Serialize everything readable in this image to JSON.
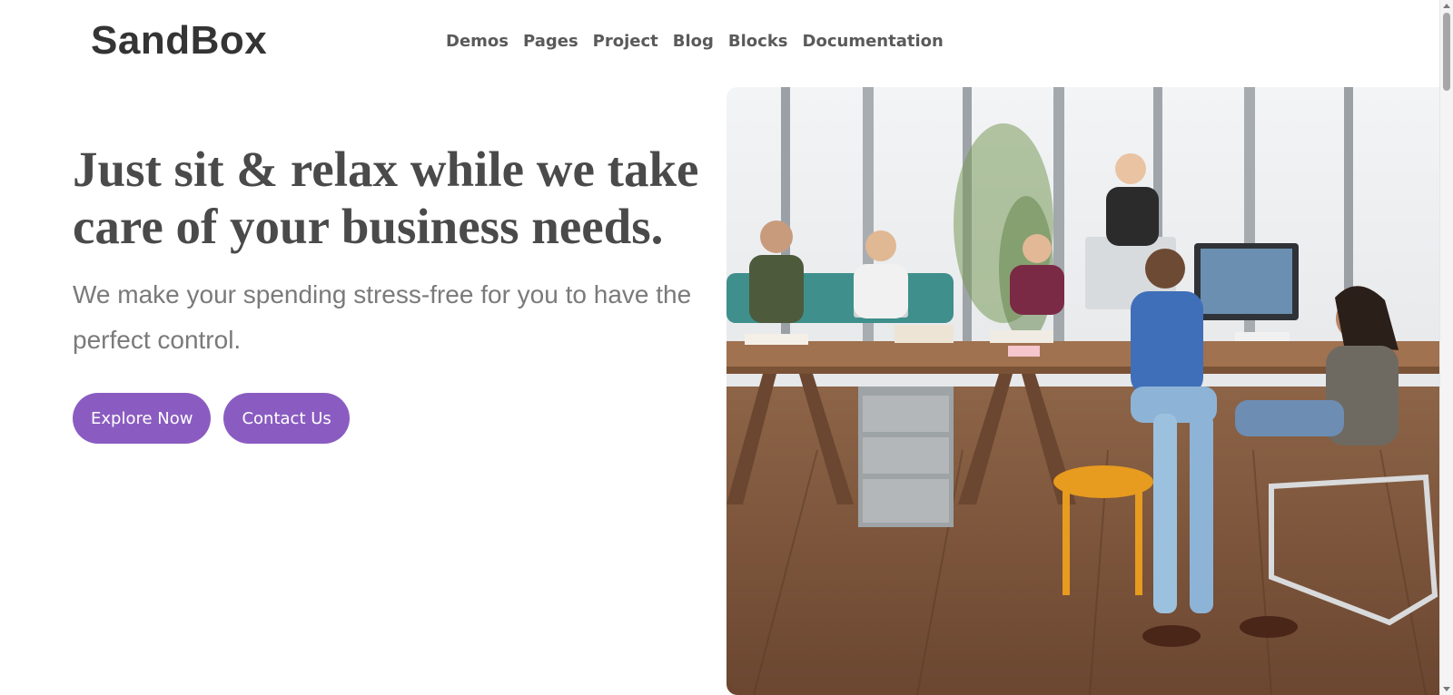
{
  "header": {
    "logo": "SandBox",
    "nav": [
      "Demos",
      "Pages",
      "Project",
      "Blog",
      "Blocks",
      "Documentation"
    ]
  },
  "hero": {
    "headline": "Just sit & relax while we take care of your business needs.",
    "subtitle": "We make your spending stress-free for you to have the perfect control.",
    "primary_button": "Explore Now",
    "secondary_button": "Contact Us",
    "image_icon": "team-office-photo"
  },
  "colors": {
    "accent": "#8a5cc1",
    "heading": "#4a4a4a",
    "body_text": "#7a7a7a"
  }
}
